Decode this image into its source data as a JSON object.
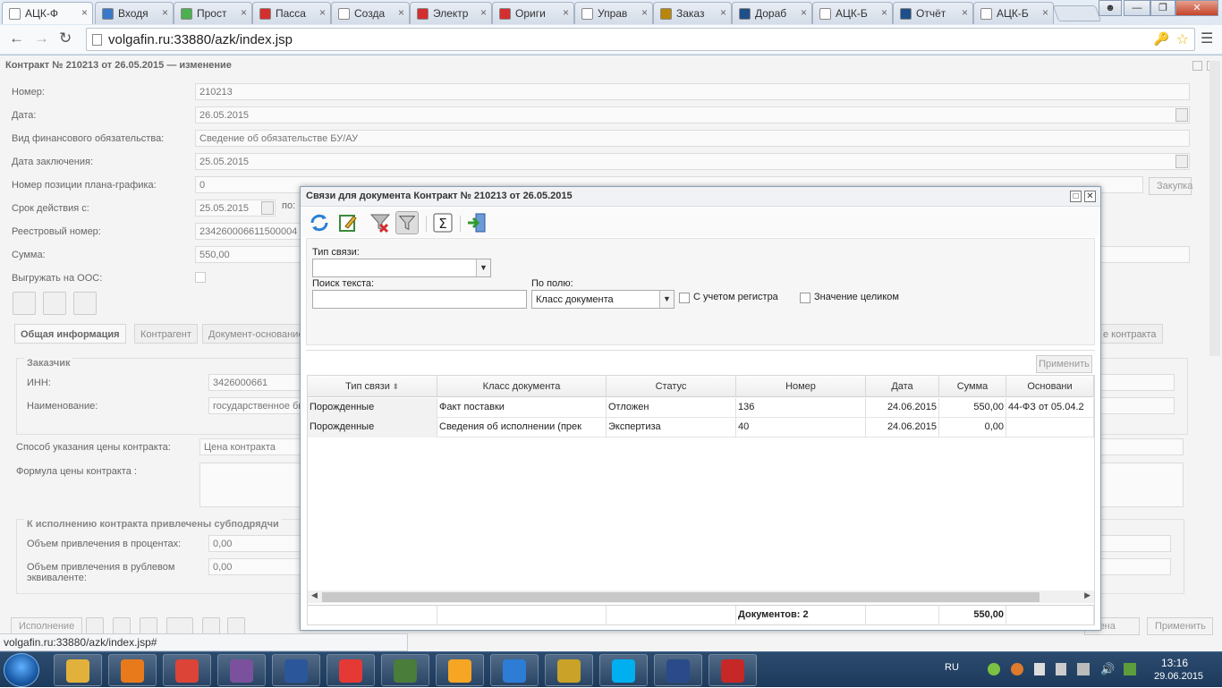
{
  "browser": {
    "tabs": [
      {
        "label": "АЦК-Ф",
        "color": "#ffffff",
        "active": true
      },
      {
        "label": "Входя",
        "color": "#3a78c9"
      },
      {
        "label": "Прост",
        "color": "#4caf50"
      },
      {
        "label": "Пасса",
        "color": "#d32f2f"
      },
      {
        "label": "Созда",
        "color": "#ffffff"
      },
      {
        "label": "Электр",
        "color": "#d32f2f"
      },
      {
        "label": "Ориги",
        "color": "#d32f2f"
      },
      {
        "label": "Управ",
        "color": "#ffffff"
      },
      {
        "label": "Заказ",
        "color": "#b8860b"
      },
      {
        "label": "Дораб",
        "color": "#1e4f8a"
      },
      {
        "label": "АЦК-Б",
        "color": "#ffffff"
      },
      {
        "label": "Отчёт",
        "color": "#1e4f8a"
      },
      {
        "label": "АЦК-Б",
        "color": "#ffffff"
      }
    ],
    "url": "volgafin.ru:33880/azk/index.jsp"
  },
  "form": {
    "title": "Контракт № 210213 от 26.05.2015 — изменение",
    "fields": [
      {
        "label": "Номер:",
        "value": "210213"
      },
      {
        "label": "Дата:",
        "value": "26.05.2015"
      },
      {
        "label": "Вид финансового обязательства:",
        "value": "Сведение об обязательстве БУ/АУ"
      },
      {
        "label": "Дата заключения:",
        "value": "25.05.2015"
      },
      {
        "label": "Номер позиции плана-графика:",
        "value": "0"
      },
      {
        "label": "Срок действия с:",
        "value": "25.05.2015"
      },
      {
        "label": "Реестровый номер:",
        "value": "234260006611500004"
      },
      {
        "label": "Сумма:",
        "value": "550,00"
      },
      {
        "label": "Выгружать на ООС:",
        "value": ""
      }
    ],
    "term_to_label": "по:",
    "purchase_button": "Закупка",
    "tabs": [
      "Общая информация",
      "Контрагент",
      "Документ-основание",
      "е контракта"
    ],
    "customer": {
      "legend": "Заказчик",
      "inn_label": "ИНН:",
      "inn_value": "3426000661",
      "name_label": "Наименование:",
      "name_value": "государственное бю"
    },
    "price_method_label": "Способ указания цены контракта:",
    "price_method_value": "Цена контракта",
    "price_formula_label": "Формула цены контракта :",
    "subcontract": {
      "legend": "К исполнению контракта привлечены субподрядчи",
      "percent_label": "Объем привлечения в процентах:",
      "percent_value": "0,00",
      "rub_label": "Объем привлечения в рублевом эквиваленте:",
      "rub_value": "0,00"
    },
    "bottom_buttons": {
      "execute": "Исполнение",
      "cancel": "мена",
      "apply": "Применить"
    }
  },
  "dialog": {
    "title": "Связи для документа Контракт № 210213 от 26.05.2015",
    "link_type_label": "Тип связи:",
    "link_type_value": "",
    "search_label": "Поиск текста:",
    "search_value": "",
    "by_field_label": "По полю:",
    "by_field_value": "Класс документа",
    "case_label": "С учетом регистра",
    "whole_label": "Значение целиком",
    "apply_label": "Применить",
    "columns": [
      "Тип связи",
      "Класс документа",
      "Статус",
      "Номер",
      "Дата",
      "Сумма",
      "Основани"
    ],
    "rows": [
      [
        "Порожденные",
        "Факт поставки",
        "Отложен",
        "136",
        "24.06.2015",
        "550,00",
        "44-ФЗ от 05.04.2"
      ],
      [
        "Порожденные",
        "Сведения об исполнении (прек",
        "Экспертиза",
        "40",
        "24.06.2015",
        "0,00",
        ""
      ]
    ],
    "footer_count": "Документов: 2",
    "footer_sum": "550,00"
  },
  "status_bar": "volgafin.ru:33880/azk/index.jsp#",
  "taskbar": {
    "lang": "RU",
    "time": "13:16",
    "date": "29.06.2015",
    "apps": [
      "#e2b13c",
      "#e87a1c",
      "#db4437",
      "#7b519d",
      "#2b579a",
      "#e53935",
      "#4a7c3a",
      "#f6a623",
      "#2d7cd6",
      "#c9a227",
      "#00aff0",
      "#2a4a8a",
      "#c62828"
    ]
  }
}
